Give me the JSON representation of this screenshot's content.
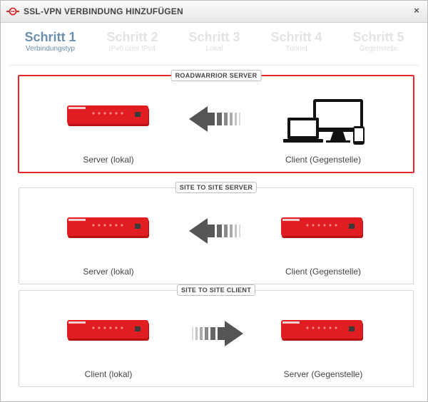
{
  "dialog": {
    "title": "SSL-VPN VERBINDUNG HINZUFÜGEN",
    "close_symbol": "×"
  },
  "steps": [
    {
      "title": "Schritt 1",
      "subtitle": "Verbindungstyp",
      "active": true
    },
    {
      "title": "Schritt 2",
      "subtitle": "IPv6 über IPv4",
      "active": false
    },
    {
      "title": "Schritt 3",
      "subtitle": "Lokal",
      "active": false
    },
    {
      "title": "Schritt 4",
      "subtitle": "Tunnel",
      "active": false
    },
    {
      "title": "Schritt 5",
      "subtitle": "Gegenstelle",
      "active": false
    }
  ],
  "options": [
    {
      "label": "ROADWARRIOR SERVER",
      "left_caption": "Server (lokal)",
      "right_caption": "Client (Gegenstelle)",
      "arrow": "left",
      "right_device": "client-devices",
      "selected": true
    },
    {
      "label": "SITE TO SITE SERVER",
      "left_caption": "Server (lokal)",
      "right_caption": "Client (Gegenstelle)",
      "arrow": "left",
      "right_device": "firewall-appliance",
      "selected": false
    },
    {
      "label": "SITE TO SITE CLIENT",
      "left_caption": "Client (lokal)",
      "right_caption": "Server (Gegenstelle)",
      "arrow": "right",
      "right_device": "firewall-appliance",
      "selected": false
    }
  ],
  "colors": {
    "active_step": "#6c8fad",
    "inactive_step": "#e3e3e3",
    "selection_border": "#e8282b",
    "appliance_red": "#d9191c"
  }
}
